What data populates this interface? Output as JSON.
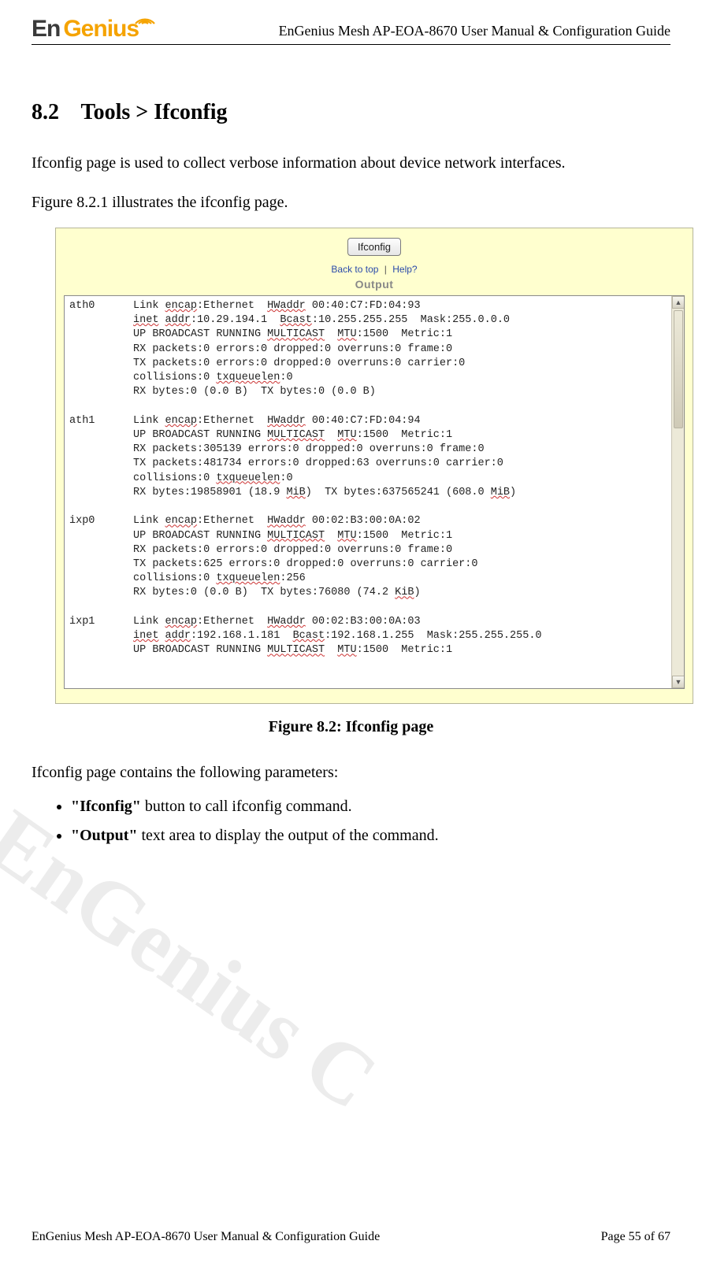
{
  "header": {
    "logo_main": "En",
    "logo_accent": "Genius",
    "doc_title": "EnGenius Mesh AP-EOA-8670 User Manual & Configuration Guide"
  },
  "section": {
    "number": "8.2",
    "title": "Tools > Ifconfig"
  },
  "paragraphs": {
    "p1": "Ifconfig page is used to collect verbose information about device network interfaces.",
    "p2": "Figure 8.2.1 illustrates the ifconfig page.",
    "p3": "Ifconfig page contains the following parameters:"
  },
  "figure": {
    "caption": "Figure 8.2: Ifconfig page"
  },
  "bullets": [
    {
      "lead": "\"Ifconfig\"",
      "rest": " button to call ifconfig command."
    },
    {
      "lead": "\"Output\"",
      "rest": " text area to display the output of the command."
    }
  ],
  "screenshot": {
    "button_label": "Ifconfig",
    "back_to_top": "Back to top",
    "help": "Help?",
    "output_label": "Output",
    "interfaces": [
      {
        "name": "ath0",
        "lines": [
          {
            "segs": [
              [
                "",
                "Link "
              ],
              [
                "u",
                "encap"
              ],
              [
                "",
                ":Ethernet  "
              ],
              [
                "u",
                "HWaddr"
              ],
              [
                "",
                " 00:40:C7:FD:04:93"
              ]
            ]
          },
          {
            "segs": [
              [
                "u",
                "inet"
              ],
              [
                "",
                " "
              ],
              [
                "u",
                "addr"
              ],
              [
                "",
                ":10.29.194.1  "
              ],
              [
                "u",
                "Bcast"
              ],
              [
                "",
                ":10.255.255.255  Mask:255.0.0.0"
              ]
            ]
          },
          {
            "segs": [
              [
                "",
                "UP BROADCAST RUNNING "
              ],
              [
                "u",
                "MULTICAST"
              ],
              [
                "",
                "  "
              ],
              [
                "u",
                "MTU"
              ],
              [
                "",
                ":1500  Metric:1"
              ]
            ]
          },
          {
            "segs": [
              [
                "",
                "RX packets:0 errors:0 dropped:0 overruns:0 frame:0"
              ]
            ]
          },
          {
            "segs": [
              [
                "",
                "TX packets:0 errors:0 dropped:0 overruns:0 carrier:0"
              ]
            ]
          },
          {
            "segs": [
              [
                "",
                "collisions:0 "
              ],
              [
                "u",
                "txqueuelen"
              ],
              [
                "",
                ":0"
              ]
            ]
          },
          {
            "segs": [
              [
                "",
                "RX bytes:0 (0.0 B)  TX bytes:0 (0.0 B)"
              ]
            ]
          }
        ]
      },
      {
        "name": "ath1",
        "lines": [
          {
            "segs": [
              [
                "",
                "Link "
              ],
              [
                "u",
                "encap"
              ],
              [
                "",
                ":Ethernet  "
              ],
              [
                "u",
                "HWaddr"
              ],
              [
                "",
                " 00:40:C7:FD:04:94"
              ]
            ]
          },
          {
            "segs": [
              [
                "",
                "UP BROADCAST RUNNING "
              ],
              [
                "u",
                "MULTICAST"
              ],
              [
                "",
                "  "
              ],
              [
                "u",
                "MTU"
              ],
              [
                "",
                ":1500  Metric:1"
              ]
            ]
          },
          {
            "segs": [
              [
                "",
                "RX packets:305139 errors:0 dropped:0 overruns:0 frame:0"
              ]
            ]
          },
          {
            "segs": [
              [
                "",
                "TX packets:481734 errors:0 dropped:63 overruns:0 carrier:0"
              ]
            ]
          },
          {
            "segs": [
              [
                "",
                "collisions:0 "
              ],
              [
                "u",
                "txqueuelen"
              ],
              [
                "",
                ":0"
              ]
            ]
          },
          {
            "segs": [
              [
                "",
                "RX bytes:19858901 (18.9 "
              ],
              [
                "u",
                "MiB"
              ],
              [
                "",
                ")  TX bytes:637565241 (608.0 "
              ],
              [
                "u",
                "MiB"
              ],
              [
                "",
                ")"
              ]
            ]
          }
        ]
      },
      {
        "name": "ixp0",
        "lines": [
          {
            "segs": [
              [
                "",
                "Link "
              ],
              [
                "u",
                "encap"
              ],
              [
                "",
                ":Ethernet  "
              ],
              [
                "u",
                "HWaddr"
              ],
              [
                "",
                " 00:02:B3:00:0A:02"
              ]
            ]
          },
          {
            "segs": [
              [
                "",
                "UP BROADCAST RUNNING "
              ],
              [
                "u",
                "MULTICAST"
              ],
              [
                "",
                "  "
              ],
              [
                "u",
                "MTU"
              ],
              [
                "",
                ":1500  Metric:1"
              ]
            ]
          },
          {
            "segs": [
              [
                "",
                "RX packets:0 errors:0 dropped:0 overruns:0 frame:0"
              ]
            ]
          },
          {
            "segs": [
              [
                "",
                "TX packets:625 errors:0 dropped:0 overruns:0 carrier:0"
              ]
            ]
          },
          {
            "segs": [
              [
                "",
                "collisions:0 "
              ],
              [
                "u",
                "txqueuelen"
              ],
              [
                "",
                ":256"
              ]
            ]
          },
          {
            "segs": [
              [
                "",
                "RX bytes:0 (0.0 B)  TX bytes:76080 (74.2 "
              ],
              [
                "u",
                "KiB"
              ],
              [
                "",
                ")"
              ]
            ]
          }
        ]
      },
      {
        "name": "ixp1",
        "lines": [
          {
            "segs": [
              [
                "",
                "Link "
              ],
              [
                "u",
                "encap"
              ],
              [
                "",
                ":Ethernet  "
              ],
              [
                "u",
                "HWaddr"
              ],
              [
                "",
                " 00:02:B3:00:0A:03"
              ]
            ]
          },
          {
            "segs": [
              [
                "u",
                "inet"
              ],
              [
                "",
                " "
              ],
              [
                "u",
                "addr"
              ],
              [
                "",
                ":192.168.1.181  "
              ],
              [
                "u",
                "Bcast"
              ],
              [
                "",
                ":192.168.1.255  Mask:255.255.255.0"
              ]
            ]
          },
          {
            "segs": [
              [
                "",
                "UP BROADCAST RUNNING "
              ],
              [
                "u",
                "MULTICAST"
              ],
              [
                "",
                "  "
              ],
              [
                "u",
                "MTU"
              ],
              [
                "",
                ":1500  Metric:1"
              ]
            ]
          }
        ]
      }
    ]
  },
  "watermark": "EnGenius C",
  "footer": {
    "left": "EnGenius Mesh AP-EOA-8670 User Manual & Configuration Guide",
    "right": "Page 55 of 67"
  }
}
